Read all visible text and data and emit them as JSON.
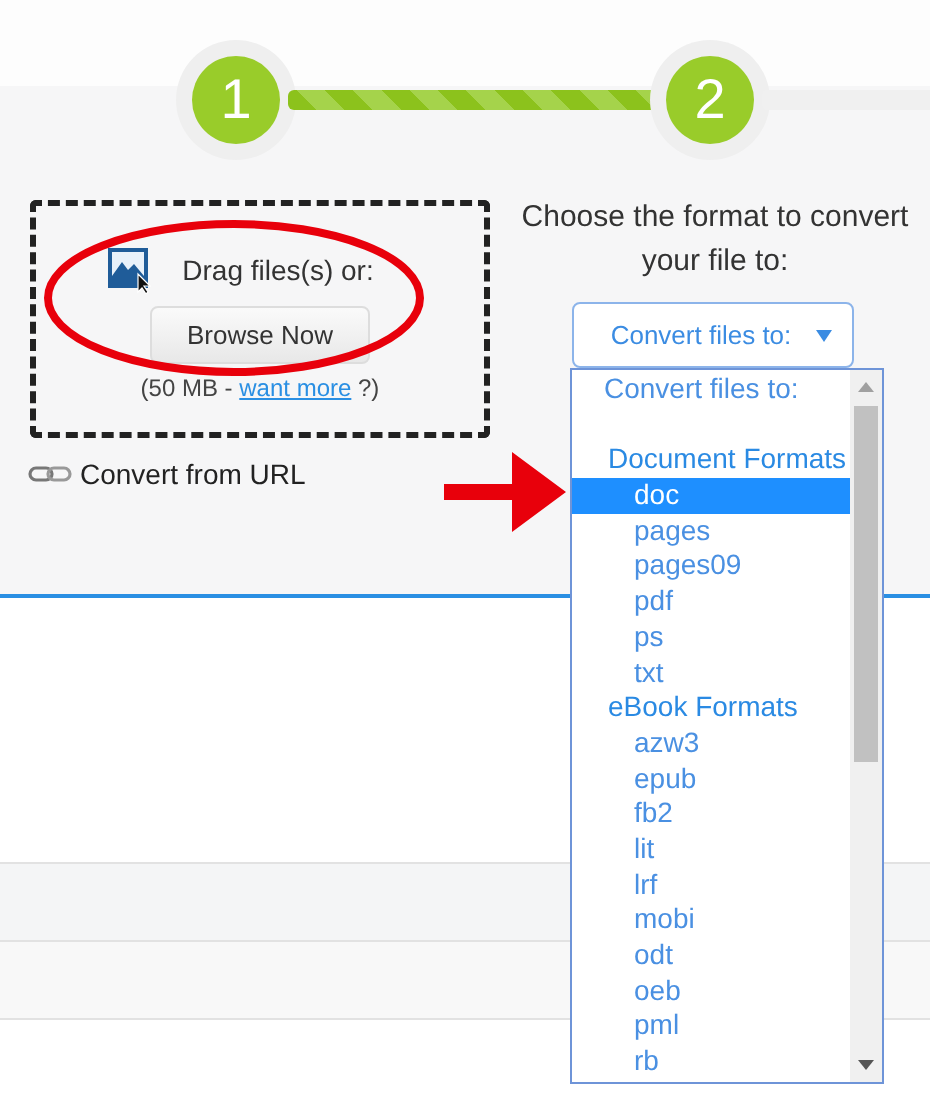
{
  "steps": [
    {
      "label": "1",
      "done": true
    },
    {
      "label": "2",
      "done": true
    }
  ],
  "upload": {
    "prompt": "Drag files(s) or:",
    "button": "Browse Now",
    "limit_prefix": "(50 MB - ",
    "limit_link": "want more",
    "limit_suffix": " ?)",
    "url_link": "Convert from URL"
  },
  "format": {
    "heading": "Choose the format to convert your file to:",
    "select": {
      "value": "Convert files to:",
      "expanded": true
    },
    "options": [
      {
        "kind": "placeholder",
        "label": "Convert files to:"
      },
      {
        "kind": "blank"
      },
      {
        "kind": "group",
        "label": "Document Formats"
      },
      {
        "kind": "option",
        "label": "doc",
        "selected": true
      },
      {
        "kind": "option",
        "label": "pages",
        "selected": false
      },
      {
        "kind": "option",
        "label": "pages09",
        "selected": false
      },
      {
        "kind": "option",
        "label": "pdf",
        "selected": false
      },
      {
        "kind": "option",
        "label": "ps",
        "selected": false
      },
      {
        "kind": "option",
        "label": "txt",
        "selected": false
      },
      {
        "kind": "group",
        "label": "eBook Formats"
      },
      {
        "kind": "option",
        "label": "azw3",
        "selected": false
      },
      {
        "kind": "option",
        "label": "epub",
        "selected": false
      },
      {
        "kind": "option",
        "label": "fb2",
        "selected": false
      },
      {
        "kind": "option",
        "label": "lit",
        "selected": false
      },
      {
        "kind": "option",
        "label": "lrf",
        "selected": false
      },
      {
        "kind": "option",
        "label": "mobi",
        "selected": false
      },
      {
        "kind": "option",
        "label": "odt",
        "selected": false
      },
      {
        "kind": "option",
        "label": "oeb",
        "selected": false
      },
      {
        "kind": "option",
        "label": "pml",
        "selected": false
      },
      {
        "kind": "option",
        "label": "rb",
        "selected": false
      }
    ]
  }
}
